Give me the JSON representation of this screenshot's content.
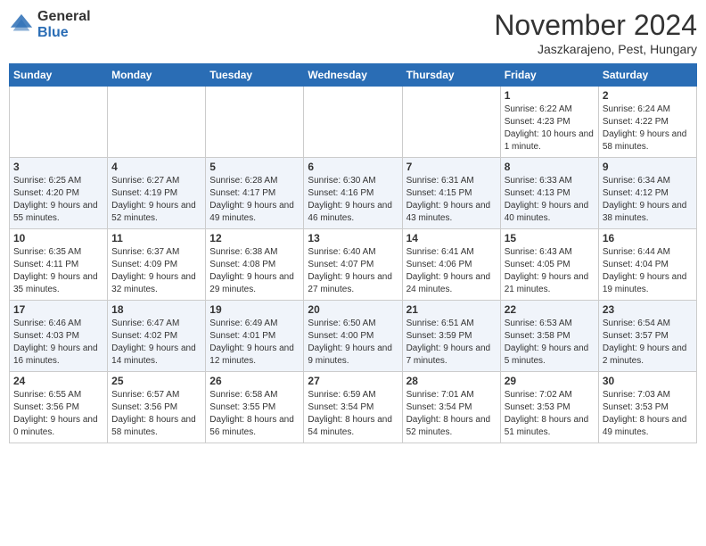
{
  "logo": {
    "general": "General",
    "blue": "Blue"
  },
  "title": {
    "month": "November 2024",
    "location": "Jaszkarajeno, Pest, Hungary"
  },
  "weekdays": [
    "Sunday",
    "Monday",
    "Tuesday",
    "Wednesday",
    "Thursday",
    "Friday",
    "Saturday"
  ],
  "weeks": [
    [
      {
        "day": "",
        "info": ""
      },
      {
        "day": "",
        "info": ""
      },
      {
        "day": "",
        "info": ""
      },
      {
        "day": "",
        "info": ""
      },
      {
        "day": "",
        "info": ""
      },
      {
        "day": "1",
        "info": "Sunrise: 6:22 AM\nSunset: 4:23 PM\nDaylight: 10 hours and 1 minute."
      },
      {
        "day": "2",
        "info": "Sunrise: 6:24 AM\nSunset: 4:22 PM\nDaylight: 9 hours and 58 minutes."
      }
    ],
    [
      {
        "day": "3",
        "info": "Sunrise: 6:25 AM\nSunset: 4:20 PM\nDaylight: 9 hours and 55 minutes."
      },
      {
        "day": "4",
        "info": "Sunrise: 6:27 AM\nSunset: 4:19 PM\nDaylight: 9 hours and 52 minutes."
      },
      {
        "day": "5",
        "info": "Sunrise: 6:28 AM\nSunset: 4:17 PM\nDaylight: 9 hours and 49 minutes."
      },
      {
        "day": "6",
        "info": "Sunrise: 6:30 AM\nSunset: 4:16 PM\nDaylight: 9 hours and 46 minutes."
      },
      {
        "day": "7",
        "info": "Sunrise: 6:31 AM\nSunset: 4:15 PM\nDaylight: 9 hours and 43 minutes."
      },
      {
        "day": "8",
        "info": "Sunrise: 6:33 AM\nSunset: 4:13 PM\nDaylight: 9 hours and 40 minutes."
      },
      {
        "day": "9",
        "info": "Sunrise: 6:34 AM\nSunset: 4:12 PM\nDaylight: 9 hours and 38 minutes."
      }
    ],
    [
      {
        "day": "10",
        "info": "Sunrise: 6:35 AM\nSunset: 4:11 PM\nDaylight: 9 hours and 35 minutes."
      },
      {
        "day": "11",
        "info": "Sunrise: 6:37 AM\nSunset: 4:09 PM\nDaylight: 9 hours and 32 minutes."
      },
      {
        "day": "12",
        "info": "Sunrise: 6:38 AM\nSunset: 4:08 PM\nDaylight: 9 hours and 29 minutes."
      },
      {
        "day": "13",
        "info": "Sunrise: 6:40 AM\nSunset: 4:07 PM\nDaylight: 9 hours and 27 minutes."
      },
      {
        "day": "14",
        "info": "Sunrise: 6:41 AM\nSunset: 4:06 PM\nDaylight: 9 hours and 24 minutes."
      },
      {
        "day": "15",
        "info": "Sunrise: 6:43 AM\nSunset: 4:05 PM\nDaylight: 9 hours and 21 minutes."
      },
      {
        "day": "16",
        "info": "Sunrise: 6:44 AM\nSunset: 4:04 PM\nDaylight: 9 hours and 19 minutes."
      }
    ],
    [
      {
        "day": "17",
        "info": "Sunrise: 6:46 AM\nSunset: 4:03 PM\nDaylight: 9 hours and 16 minutes."
      },
      {
        "day": "18",
        "info": "Sunrise: 6:47 AM\nSunset: 4:02 PM\nDaylight: 9 hours and 14 minutes."
      },
      {
        "day": "19",
        "info": "Sunrise: 6:49 AM\nSunset: 4:01 PM\nDaylight: 9 hours and 12 minutes."
      },
      {
        "day": "20",
        "info": "Sunrise: 6:50 AM\nSunset: 4:00 PM\nDaylight: 9 hours and 9 minutes."
      },
      {
        "day": "21",
        "info": "Sunrise: 6:51 AM\nSunset: 3:59 PM\nDaylight: 9 hours and 7 minutes."
      },
      {
        "day": "22",
        "info": "Sunrise: 6:53 AM\nSunset: 3:58 PM\nDaylight: 9 hours and 5 minutes."
      },
      {
        "day": "23",
        "info": "Sunrise: 6:54 AM\nSunset: 3:57 PM\nDaylight: 9 hours and 2 minutes."
      }
    ],
    [
      {
        "day": "24",
        "info": "Sunrise: 6:55 AM\nSunset: 3:56 PM\nDaylight: 9 hours and 0 minutes."
      },
      {
        "day": "25",
        "info": "Sunrise: 6:57 AM\nSunset: 3:56 PM\nDaylight: 8 hours and 58 minutes."
      },
      {
        "day": "26",
        "info": "Sunrise: 6:58 AM\nSunset: 3:55 PM\nDaylight: 8 hours and 56 minutes."
      },
      {
        "day": "27",
        "info": "Sunrise: 6:59 AM\nSunset: 3:54 PM\nDaylight: 8 hours and 54 minutes."
      },
      {
        "day": "28",
        "info": "Sunrise: 7:01 AM\nSunset: 3:54 PM\nDaylight: 8 hours and 52 minutes."
      },
      {
        "day": "29",
        "info": "Sunrise: 7:02 AM\nSunset: 3:53 PM\nDaylight: 8 hours and 51 minutes."
      },
      {
        "day": "30",
        "info": "Sunrise: 7:03 AM\nSunset: 3:53 PM\nDaylight: 8 hours and 49 minutes."
      }
    ]
  ]
}
